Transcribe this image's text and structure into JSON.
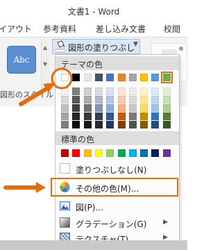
{
  "window": {
    "title": "文書1 - Word"
  },
  "tabs": [
    "イアウト",
    "参考資料",
    "差し込み文書",
    "校閲"
  ],
  "ribbon": {
    "abc_label": "Abc",
    "group_label": "図形のスタイル",
    "fill_button_label": "図形の塗りつぶし"
  },
  "menu": {
    "theme_header": "テーマの色",
    "standard_header": "標準の色",
    "no_fill": "塗りつぶしなし(N)",
    "more_colors": "その他の色(M)...",
    "picture": "図(P)...",
    "gradient": "グラデーション(G)",
    "texture": "テクスチャ(T)"
  },
  "colors": {
    "accent": "#e46c0a",
    "theme_top": [
      "#ffffff",
      "#000000",
      "#e7e6e6",
      "#44546a",
      "#4472c4",
      "#ed7d31",
      "#a5a5a5",
      "#ffc000",
      "#5b9bd5",
      "#70ad47"
    ],
    "theme_tints": [
      [
        "#f2f2f2",
        "#7f7f7f",
        "#d0cece",
        "#d6dce5",
        "#dae3f3",
        "#fbe5d6",
        "#ededed",
        "#fff2cc",
        "#deebf7",
        "#e2f0d9"
      ],
      [
        "#d9d9d9",
        "#595959",
        "#aeabab",
        "#adb9ca",
        "#b4c7e7",
        "#f8cbad",
        "#dbdbdb",
        "#ffe699",
        "#bdd7ee",
        "#c5e0b4"
      ],
      [
        "#bfbfbf",
        "#404040",
        "#757171",
        "#8497b0",
        "#8faadc",
        "#f4b183",
        "#c9c9c9",
        "#ffd966",
        "#9dc3e6",
        "#a9d18e"
      ],
      [
        "#a6a6a6",
        "#262626",
        "#3a3838",
        "#333f50",
        "#2f5597",
        "#c55a11",
        "#7b7b7b",
        "#bf9000",
        "#2e75b6",
        "#538135"
      ],
      [
        "#7f7f7f",
        "#0d0d0d",
        "#171616",
        "#222a35",
        "#203864",
        "#843c0c",
        "#525252",
        "#7f6000",
        "#1f4e79",
        "#385723"
      ]
    ],
    "standard": [
      "#c00000",
      "#ff0000",
      "#ffc000",
      "#ffff00",
      "#92d050",
      "#00b050",
      "#00b0f0",
      "#0070c0",
      "#002060",
      "#7030a0"
    ]
  }
}
